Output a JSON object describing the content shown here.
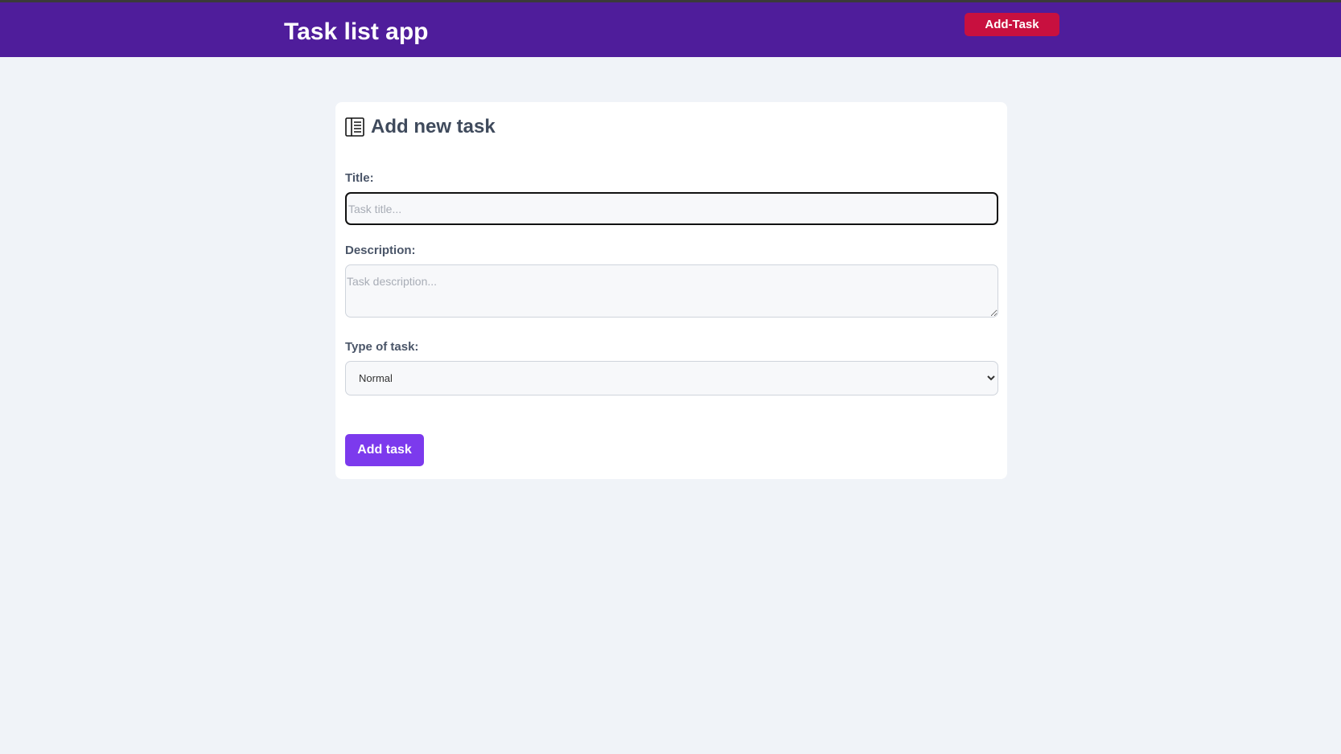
{
  "header": {
    "app_title": "Task list app",
    "add_task_button_label": "Add-Task"
  },
  "form": {
    "heading_icon": "list-document-icon",
    "heading": "Add new task",
    "title_label": "Title:",
    "title_placeholder": "Task title...",
    "title_value": "",
    "description_label": "Description:",
    "description_placeholder": "Task description...",
    "description_value": "",
    "type_label": "Type of task:",
    "type_selected": "Normal",
    "submit_label": "Add task"
  },
  "colors": {
    "navbar": "#4f1d9b",
    "nav_button": "#c8103f",
    "submit_button": "#7c3aed",
    "page_background": "#f0f3f8"
  }
}
